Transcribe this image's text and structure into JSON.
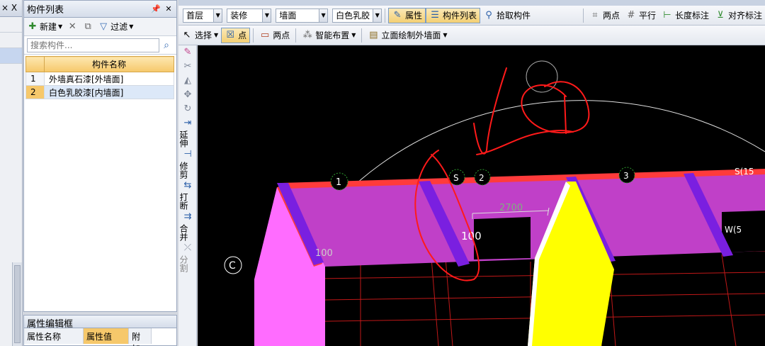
{
  "left_strip": {
    "header_label": "× X"
  },
  "component_panel": {
    "title": "构件列表",
    "toolbar": {
      "new_label": "新建",
      "filter_label": "过滤"
    },
    "search_placeholder": "搜索构件...",
    "column_header": "构件名称",
    "rows": [
      {
        "num": "1",
        "name": "外墙真石漆[外墙面]"
      },
      {
        "num": "2",
        "name": "白色乳胶漆[内墙面]"
      }
    ]
  },
  "property_panel": {
    "title": "属性编辑框",
    "col_name": "属性名称",
    "col_value": "属性值",
    "col_extra": "附加"
  },
  "toolbar1": {
    "floor": "首层",
    "category": "装修",
    "type": "墙面",
    "component": "白色乳胶",
    "properties": "属性",
    "component_list": "构件列表",
    "pick_component": "拾取构件",
    "two_points": "两点",
    "parallel": "平行",
    "length_dim": "长度标注",
    "align_dim": "对齐标注"
  },
  "toolbar2": {
    "select": "选择",
    "point": "点",
    "two_points": "两点",
    "smart_layout": "智能布置",
    "elevation_draw": "立面绘制外墙面"
  },
  "vertical_tools": [
    {
      "icon": "extend-icon",
      "label": "延伸"
    },
    {
      "icon": "trim-icon",
      "label": "修剪"
    },
    {
      "icon": "break-icon",
      "label": "打断"
    },
    {
      "icon": "merge-icon",
      "label": "合并"
    },
    {
      "icon": "split-icon",
      "label": "分割"
    }
  ],
  "canvas": {
    "dim_text": "2700",
    "label_100_a": "100",
    "label_100_b": "100",
    "axis_c": "C",
    "axis_1": "1",
    "axis_2": "2",
    "axis_s": "S",
    "axis_3": "3",
    "label_right": "S(15",
    "label_mid": "W(5",
    "colors": {
      "wall_top": "#ff3b3b",
      "wall_face": "#c040c8",
      "pillar": "#7a1fe0",
      "yellow": "#ffff00",
      "pink": "#ff6cff"
    }
  }
}
